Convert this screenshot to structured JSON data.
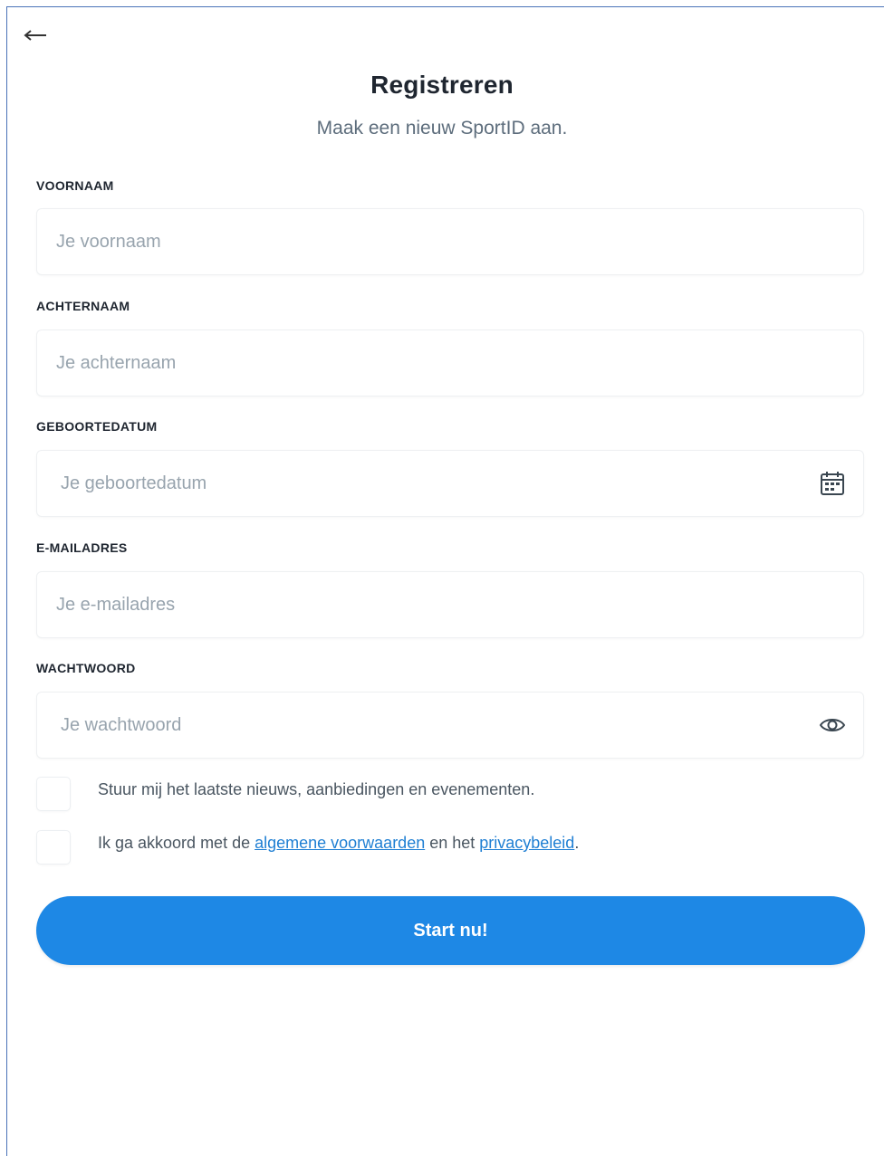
{
  "header": {
    "back_icon": "arrow-left-icon",
    "title": "Registreren",
    "subtitle": "Maak een nieuw SportID aan."
  },
  "form": {
    "first_name": {
      "label": "VOORNAAM",
      "placeholder": "Je voornaam",
      "value": ""
    },
    "last_name": {
      "label": "ACHTERNAAM",
      "placeholder": "Je achternaam",
      "value": ""
    },
    "birthdate": {
      "label": "GEBOORTEDATUM",
      "placeholder": "Je geboortedatum",
      "value": "",
      "icon": "calendar-icon"
    },
    "email": {
      "label": "E-MAILADRES",
      "placeholder": "Je e-mailadres",
      "value": ""
    },
    "password": {
      "label": "WACHTWOORD",
      "placeholder": "Je wachtwoord",
      "value": "",
      "icon": "eye-icon"
    },
    "newsletter": {
      "label": "Stuur mij het laatste nieuws, aanbiedingen en evenementen.",
      "checked": false
    },
    "terms": {
      "prefix": "Ik ga akkoord met de ",
      "terms_link": "algemene voorwaarden",
      "middle": " en het ",
      "privacy_link": "privacybeleid",
      "suffix": ".",
      "checked": false
    },
    "submit_label": "Start nu!"
  },
  "colors": {
    "primary": "#1e88e5",
    "link": "#1f7fd3",
    "frame_border": "#4a73b8"
  }
}
